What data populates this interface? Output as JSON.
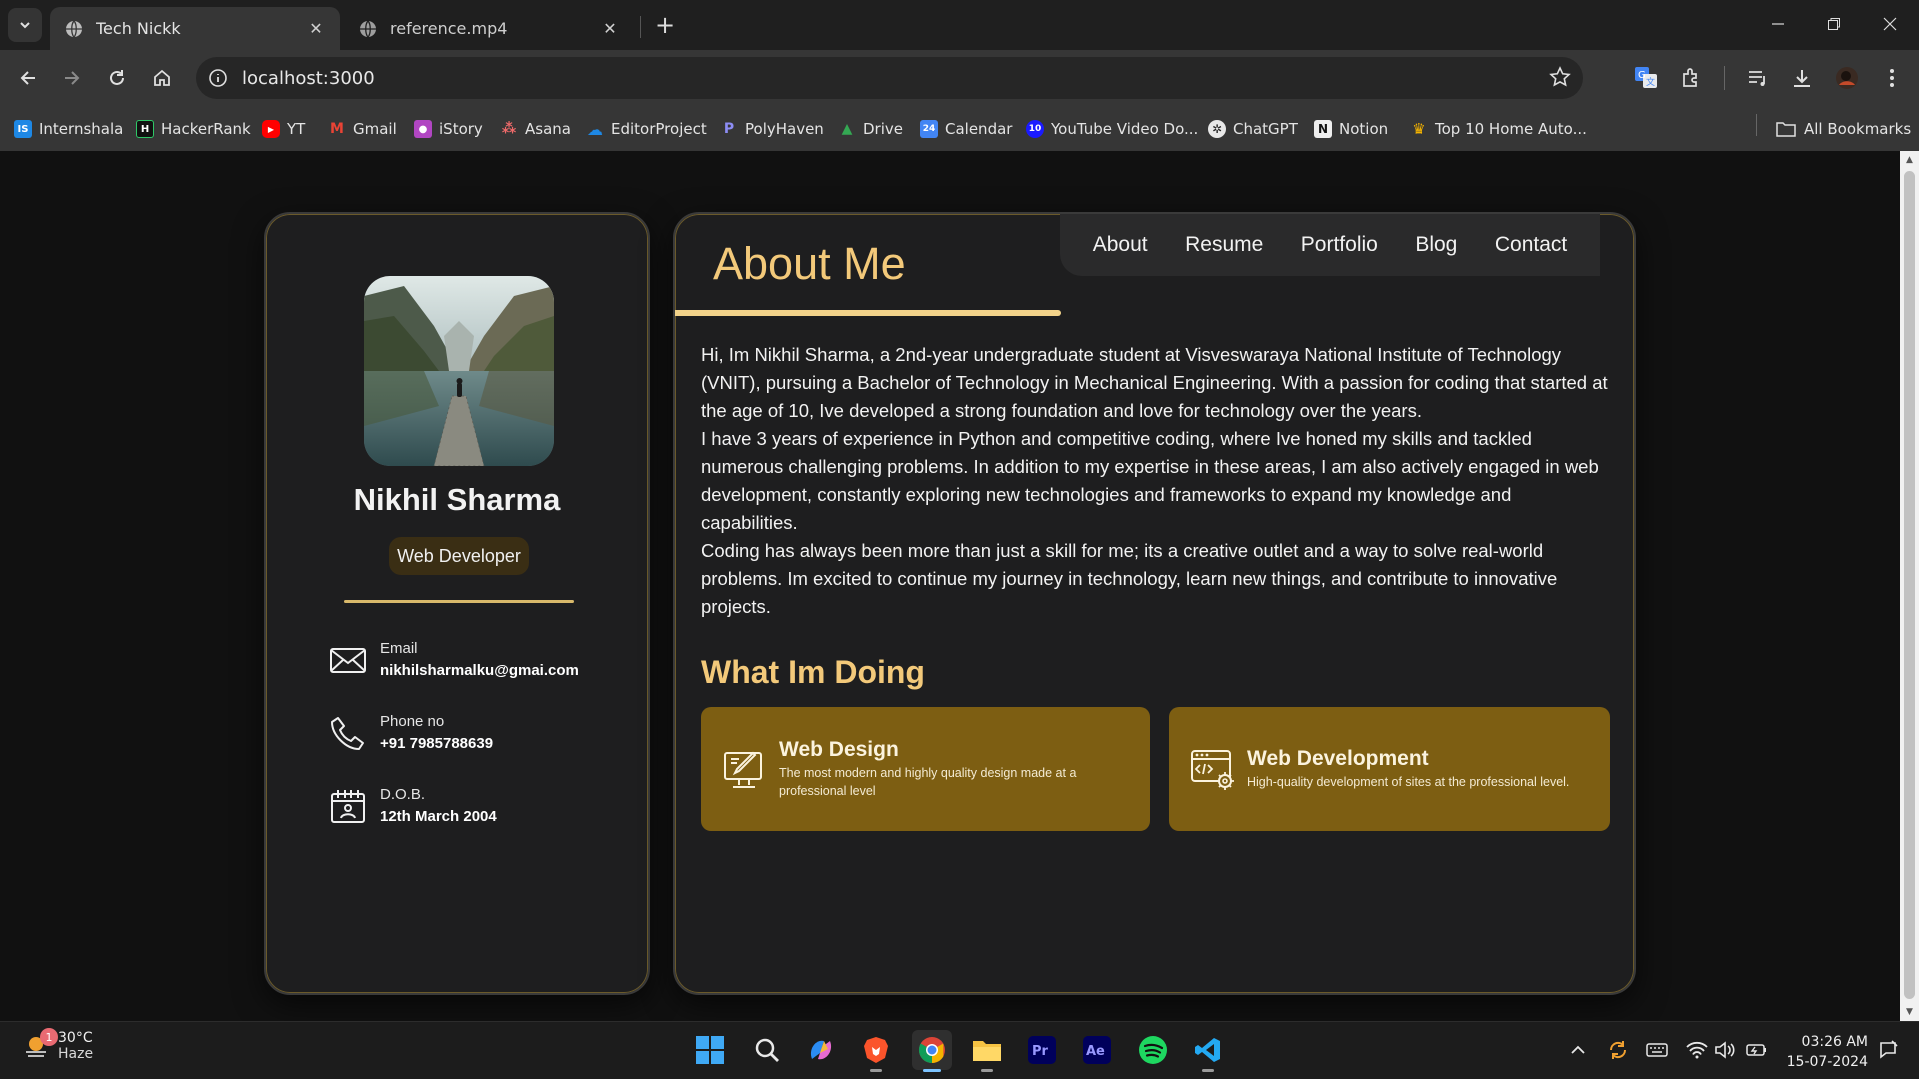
{
  "browser": {
    "tabs": [
      {
        "title": "Tech Nickk",
        "active": true
      },
      {
        "title": "reference.mp4",
        "active": false
      }
    ],
    "url": "localhost:3000",
    "bookmarks": [
      {
        "label": "Internshala",
        "icon": "internshala-icon",
        "color": "#1e88e5",
        "mark": "IS"
      },
      {
        "label": "HackerRank",
        "icon": "hackerrank-icon",
        "color": "#111111",
        "mark": "H"
      },
      {
        "label": "YT",
        "icon": "youtube-icon",
        "color": "#ff0000",
        "mark": "▶"
      },
      {
        "label": "Gmail",
        "icon": "gmail-icon",
        "color": "#ea4335",
        "mark": "M"
      },
      {
        "label": "iStory",
        "icon": "istory-icon",
        "color": "#b146c2",
        "mark": "●"
      },
      {
        "label": "Asana",
        "icon": "asana-icon",
        "color": "#f06a6a",
        "mark": "⁂"
      },
      {
        "label": "EditorProject",
        "icon": "onedrive-icon",
        "color": "#1e88e5",
        "mark": "☁"
      },
      {
        "label": "PolyHaven",
        "icon": "polyhaven-icon",
        "color": "#6c6cf0",
        "mark": "P"
      },
      {
        "label": "Drive",
        "icon": "drive-icon",
        "color": "#34a853",
        "mark": "▲"
      },
      {
        "label": "Calendar",
        "icon": "calendar-icon",
        "color": "#4285f4",
        "mark": "24"
      },
      {
        "label": "YouTube Video Do...",
        "icon": "video-downloader-icon",
        "color": "#1a1aff",
        "mark": "10"
      },
      {
        "label": "ChatGPT",
        "icon": "chatgpt-icon",
        "color": "#3a3a3a",
        "mark": "✲"
      },
      {
        "label": "Notion",
        "icon": "notion-icon",
        "color": "#eeeeee",
        "mark": "N"
      },
      {
        "label": "Top 10 Home Auto...",
        "icon": "crown-icon",
        "color": "#f5b400",
        "mark": "♛"
      }
    ],
    "all_bookmarks": "All Bookmarks"
  },
  "page": {
    "nav": [
      "About",
      "Resume",
      "Portfolio",
      "Blog",
      "Contact"
    ],
    "profile": {
      "name": "Nikhil Sharma",
      "role": "Web Developer",
      "contacts": [
        {
          "label": "Email",
          "value": "nikhilsharmalku@gmai.com",
          "icon": "mail-icon"
        },
        {
          "label": "Phone no",
          "value": "+91 7985788639",
          "icon": "phone-icon"
        },
        {
          "label": "D.O.B.",
          "value": "12th March 2004",
          "icon": "calendar-icon"
        }
      ]
    },
    "about": {
      "title": "About Me",
      "paragraphs": [
        "Hi, Im Nikhil Sharma, a 2nd-year undergraduate student at Visveswaraya National Institute of Technology (VNIT), pursuing a Bachelor of Technology in Mechanical Engineering. With a passion for coding that started at the age of 10, Ive developed a strong foundation and love for technology over the years.",
        "I have 3 years of experience in Python and competitive coding, where Ive honed my skills and tackled numerous challenging problems. In addition to my expertise in these areas, I am also actively engaged in web development, constantly exploring new technologies and frameworks to expand my knowledge and capabilities.",
        "Coding has always been more than just a skill for me; its a creative outlet and a way to solve real-world problems. Im excited to continue my journey in technology, learn new things, and contribute to innovative projects."
      ],
      "doing_title": "What Im Doing",
      "services": [
        {
          "title": "Web Design",
          "desc": "The most modern and highly quality design made at a professional level",
          "icon": "design-monitor-icon"
        },
        {
          "title": "Web Development",
          "desc": "High-quality development of sites at the professional level.",
          "icon": "code-gear-icon"
        }
      ]
    },
    "colors": {
      "accent": "#f3c97a",
      "card": "#1e1e1f",
      "service": "#7d5e12"
    }
  },
  "taskbar": {
    "weather_temp": "30°C",
    "weather_cond": "Haze",
    "weather_badge": "1",
    "time": "03:26 AM",
    "date": "15-07-2024"
  }
}
